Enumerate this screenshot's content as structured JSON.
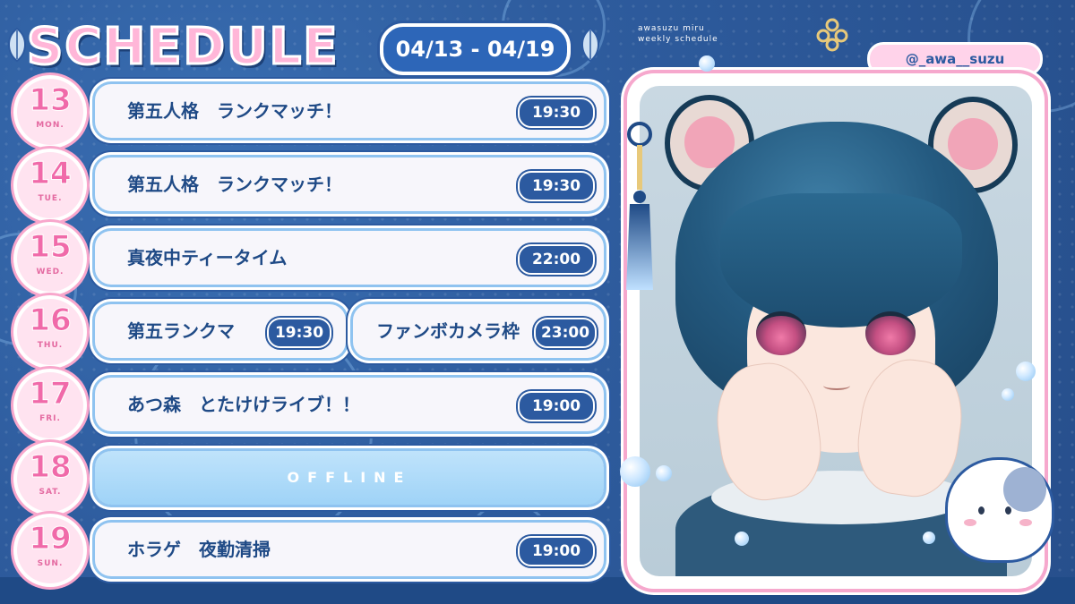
{
  "header": {
    "title": "SCHEDULE",
    "date_range": "04/13 - 04/19",
    "subtitle_line1": "awasuzu miru",
    "subtitle_line2": "weekly schedule",
    "handle": "@_awa__suzu"
  },
  "colors": {
    "background": "#2e5c9e",
    "accent_pink": "#f06aa9",
    "pill_blue": "#2c5aa0",
    "card_bg": "#f7f6fb",
    "offline_bg": "#9fd3f7"
  },
  "schedule": [
    {
      "day": "13",
      "weekday": "MON.",
      "events": [
        {
          "title": "第五人格　ランクマッチ！",
          "time": "19:30"
        }
      ]
    },
    {
      "day": "14",
      "weekday": "TUE.",
      "events": [
        {
          "title": "第五人格　ランクマッチ！",
          "time": "19:30"
        }
      ]
    },
    {
      "day": "15",
      "weekday": "WED.",
      "events": [
        {
          "title": "真夜中ティータイム",
          "time": "22:00"
        }
      ]
    },
    {
      "day": "16",
      "weekday": "THU.",
      "events": [
        {
          "title": "第五ランクマ",
          "time": "19:30"
        },
        {
          "title": "ファンボカメラ枠",
          "time": "23:00"
        }
      ]
    },
    {
      "day": "17",
      "weekday": "FRI.",
      "events": [
        {
          "title": "あつ森　とたけけライブ！！",
          "time": "19:00"
        }
      ]
    },
    {
      "day": "18",
      "weekday": "SAT.",
      "events": [
        {
          "title": "OFFLINE",
          "time": ""
        }
      ]
    },
    {
      "day": "19",
      "weekday": "SUN.",
      "events": [
        {
          "title": "ホラゲ　夜勤清掃",
          "time": "19:00"
        }
      ]
    }
  ],
  "icons": [
    "ribbon-ornament-icon",
    "tassel-icon",
    "leaf-icon",
    "hamster-mascot-icon",
    "bubble-icon"
  ]
}
